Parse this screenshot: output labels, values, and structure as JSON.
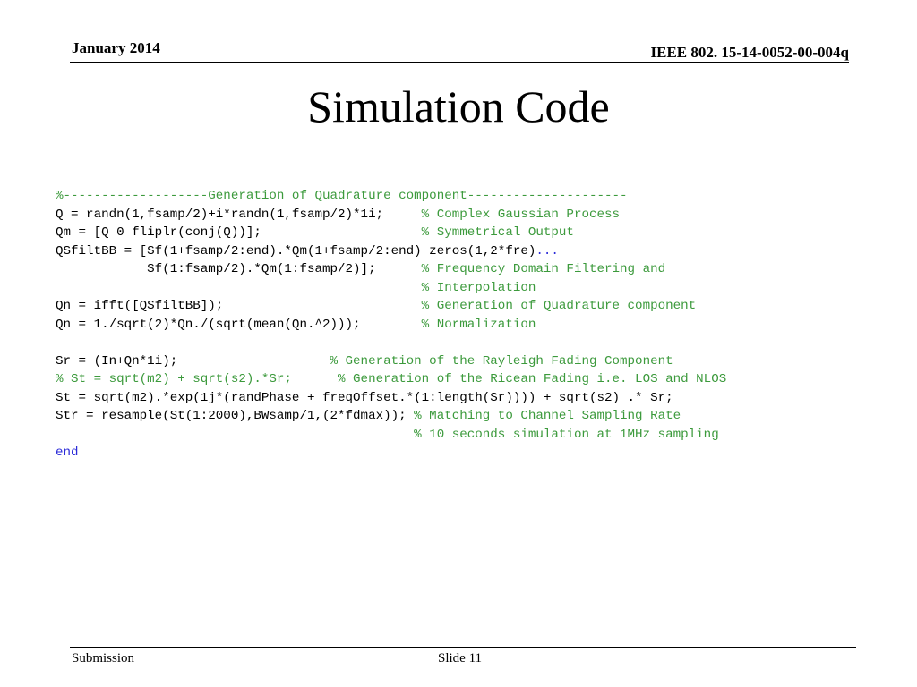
{
  "header": {
    "date": "January 2014",
    "doc_id": "IEEE 802. 15-14-0052-00-004q"
  },
  "title": "Simulation Code",
  "code": {
    "l1": "%-------------------Generation of Quadrature component---------------------",
    "l2_code": "Q = randn(1,fsamp/2)+i*randn(1,fsamp/2)*1i;     ",
    "l2_comment": "% Complex Gaussian Process",
    "l3_code": "Qm = [Q 0 fliplr(conj(Q))];                     ",
    "l3_comment": "% Symmetrical Output",
    "l4_code": "QSfiltBB = [Sf(1+fsamp/2:end).*Qm(1+fsamp/2:end) zeros(1,2*fre)",
    "l4_continuation": "...",
    "l5_code": "            Sf(1:fsamp/2).*Qm(1:fsamp/2)];      ",
    "l5_comment": "% Frequency Domain Filtering and",
    "l6_code": "                                                ",
    "l6_comment": "% Interpolation",
    "l7_code": "Qn = ifft([QSfiltBB]);                          ",
    "l7_comment": "% Generation of Quadrature component",
    "l8_code": "Qn = 1./sqrt(2)*Qn./(sqrt(mean(Qn.^2)));        ",
    "l8_comment": "% Normalization",
    "l10_code": "Sr = (In+Qn*1i);                    ",
    "l10_comment": "% Generation of the Rayleigh Fading Component",
    "l11_comment_a": "% St = sqrt(m2) + sqrt(s2).*Sr;      ",
    "l11_comment_b": "% Generation of the Ricean Fading i.e. LOS and NLOS",
    "l12_code": "St = sqrt(m2).*exp(1j*(randPhase + freqOffset.*(1:length(Sr)))) + sqrt(s2) .* Sr;",
    "l13_code": "Str = resample(St(1:2000),BWsamp/1,(2*fdmax)); ",
    "l13_comment": "% Matching to Channel Sampling Rate",
    "l14_code": "                                               ",
    "l14_comment": "% 10 seconds simulation at 1MHz sampling",
    "l15_keyword": "end"
  },
  "footer": {
    "left": "Submission",
    "center": "Slide 11"
  },
  "colors": {
    "comment": "#3c9a3c",
    "keyword": "#2b2bd8",
    "text": "#000000"
  }
}
